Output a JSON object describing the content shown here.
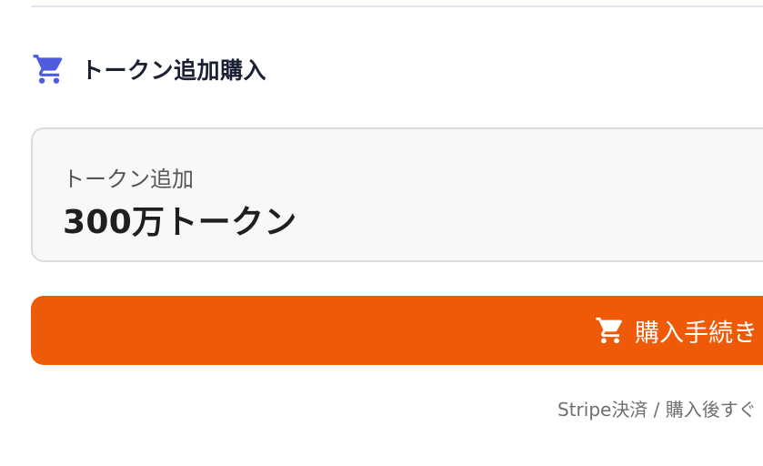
{
  "section": {
    "title": "トークン追加購入",
    "icon": "cart-icon"
  },
  "token_card": {
    "label": "トークン追加",
    "amount": "300万トークン"
  },
  "purchase_button": {
    "label": "購入手続き",
    "icon": "cart-icon"
  },
  "footnote": {
    "text": "Stripe決済 / 購入後すぐ"
  },
  "colors": {
    "accent_orange": "#ee5a07",
    "header_icon": "#4f5be0",
    "title_text": "#1b2033"
  }
}
